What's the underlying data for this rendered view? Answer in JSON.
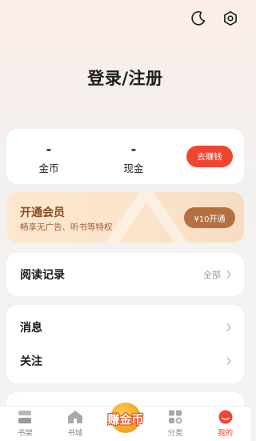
{
  "header": {
    "login_label": "登录/注册",
    "icons": [
      "moon-icon",
      "settings-icon"
    ]
  },
  "stats": {
    "coins_value": "-",
    "coins_label": "金币",
    "cash_value": "-",
    "cash_label": "现金",
    "earn_button": "去赚钱"
  },
  "vip": {
    "title": "开通会员",
    "subtitle": "畅享无广告、听书等特权",
    "button": "¥10开通"
  },
  "history": {
    "label": "阅读记录",
    "right_text": "全部"
  },
  "menu": {
    "messages": "消息",
    "follow": "关注"
  },
  "tabbar": {
    "bookshelf": "书架",
    "bookstore": "书城",
    "earn": "赚金币",
    "category": "分类",
    "mine": "我的"
  },
  "colors": {
    "accent": "#f2452e",
    "vip_button": "#b5703f",
    "vip_title": "#8a4a1d"
  }
}
